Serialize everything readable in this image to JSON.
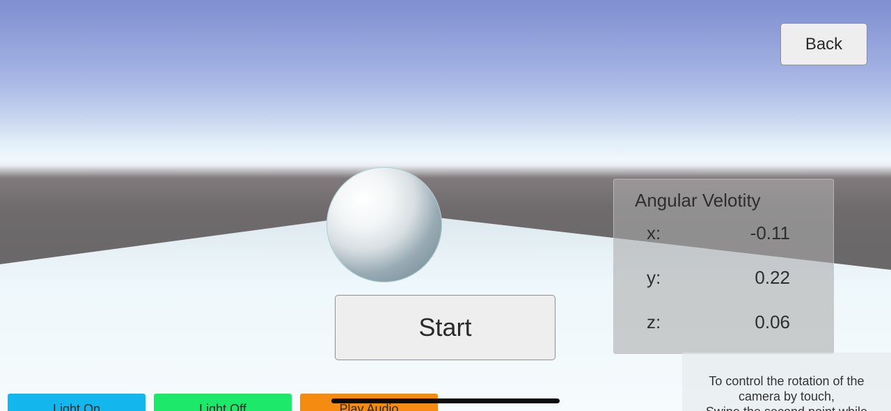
{
  "header": {
    "back_label": "Back"
  },
  "main": {
    "start_label": "Start"
  },
  "angular_velocity": {
    "title": "Angular Velotity",
    "rows": [
      {
        "axis": "x:",
        "value": "-0.11"
      },
      {
        "axis": "y:",
        "value": "0.22"
      },
      {
        "axis": "z:",
        "value": "0.06"
      }
    ]
  },
  "help": {
    "lines": [
      "To control the rotation of the",
      "camera by touch,",
      "Swipe the second point while"
    ]
  },
  "bottom_buttons": [
    {
      "label": "Light On",
      "color": "#14b6ee"
    },
    {
      "label": "Light Off",
      "color": "#1ee86a"
    },
    {
      "label": "Play Audio",
      "color": "#f58b10"
    }
  ],
  "colors": {
    "sky_top": "#7f8fd0",
    "horizon": "#f2f8fd",
    "ground": "#eef6fa",
    "wall": "#6b6869"
  }
}
